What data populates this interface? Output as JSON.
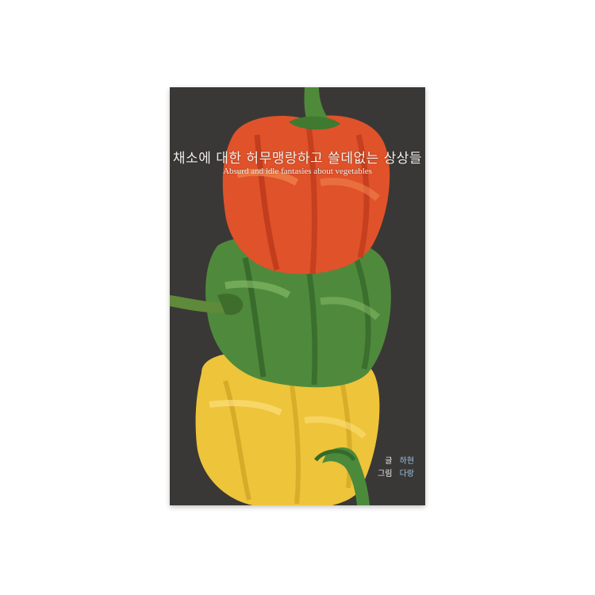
{
  "book": {
    "title_ko": "채소에 대한 허무맹랑하고 쓸데없는 상상들",
    "title_en": "Absurd and idle fantasies about vegetables",
    "credits": [
      {
        "role": "글",
        "name": "하현"
      },
      {
        "role": "그림",
        "name": "다랑"
      }
    ]
  },
  "colors": {
    "background": "#ffffff",
    "cover": "#3a3836",
    "red_pepper": "#e0522a",
    "green_pepper": "#4f8a3c",
    "yellow_pepper": "#f0c83a",
    "title_text": "#f2efe9",
    "name_text": "#9ec6e8"
  },
  "illustration": {
    "subject": "three bell peppers stacked vertically: red on top, green in the middle, yellow at the bottom"
  }
}
